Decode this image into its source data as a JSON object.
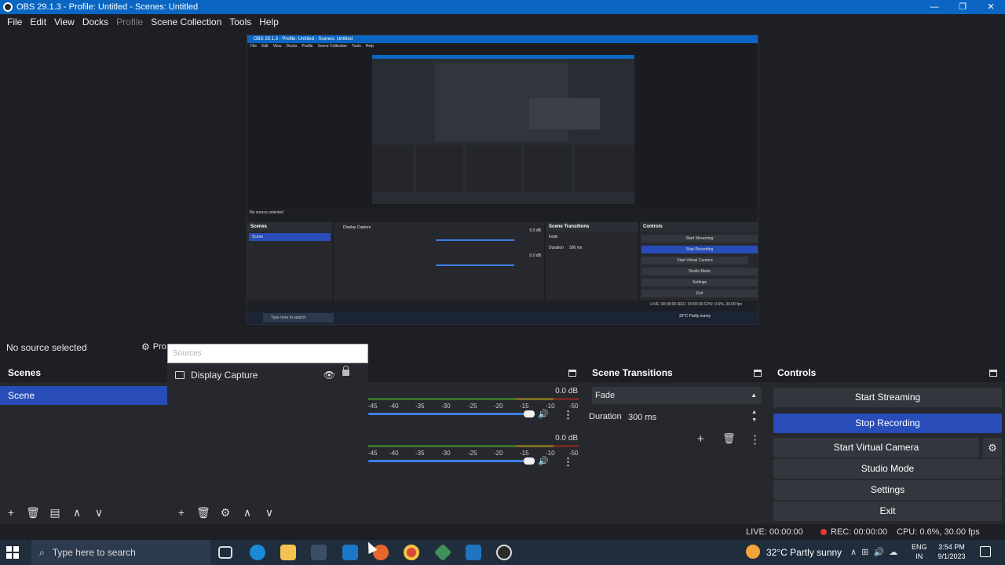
{
  "window": {
    "title": "OBS 29.1.3 - Profile: Untitled - Scenes: Untitled",
    "min": "—",
    "restore": "❐",
    "close": "✕"
  },
  "menu": [
    "File",
    "Edit",
    "View",
    "Docks",
    "Profile",
    "Scene Collection",
    "Tools",
    "Help"
  ],
  "context": {
    "no_source": "No source selected",
    "properties": "Pro"
  },
  "drag_popup": {
    "label": "Sources"
  },
  "scenes": {
    "title": "Scenes",
    "items": [
      "Scene"
    ]
  },
  "sources": {
    "items": [
      {
        "name": "Display Capture"
      }
    ]
  },
  "mixer": {
    "channels": [
      {
        "db": "0.0 dB"
      },
      {
        "db": "0.0 dB"
      }
    ],
    "ticks": [
      "-45",
      "-40",
      "-35",
      "-30",
      "-25",
      "-20",
      "-15",
      "-10",
      "-5",
      "0"
    ]
  },
  "transitions": {
    "title": "Scene Transitions",
    "selected": "Fade",
    "duration_label": "Duration",
    "duration_value": "300 ms"
  },
  "controls": {
    "title": "Controls",
    "start_streaming": "Start Streaming",
    "stop_recording": "Stop Recording",
    "start_virtual_camera": "Start Virtual Camera",
    "studio_mode": "Studio Mode",
    "settings": "Settings",
    "exit": "Exit"
  },
  "status": {
    "live": "LIVE: 00:00:00",
    "rec": "REC: 00:00:00",
    "cpu": "CPU: 0.6%, 30.00 fps"
  },
  "taskbar": {
    "search_placeholder": "Type here to search",
    "weather": "32°C  Partly sunny",
    "lang1": "ENG",
    "lang2": "IN",
    "time": "3:54 PM",
    "date": "9/1/2023"
  },
  "mini": {
    "title": "OBS 29.1.3 - Profile: Untitled - Scenes: Untitled",
    "no_source": "No source selected",
    "scenes": "Scenes",
    "scene": "Scene",
    "display_capture": "Display Capture",
    "transitions": "Scene Transitions",
    "fade": "Fade",
    "duration": "Duration",
    "duration_value": "300 ms",
    "controls": "Controls",
    "start_streaming": "Start Streaming",
    "stop_recording": "Stop Recording",
    "start_virtual_camera": "Start Virtual Camera",
    "studio_mode": "Studio Mode",
    "settings": "Settings",
    "exit": "Exit",
    "status": "LIVE: 00:00:00   REC: 00:00:00   CPU: 0.6%, 30.00 fps",
    "search": "Type here to search",
    "weather": "32°C  Partly sunny"
  },
  "colors": {
    "accent": "#284cb8",
    "titlebar": "#0a66c2",
    "panel": "#26282e",
    "background": "#1e1f24",
    "rec": "#e53935"
  }
}
